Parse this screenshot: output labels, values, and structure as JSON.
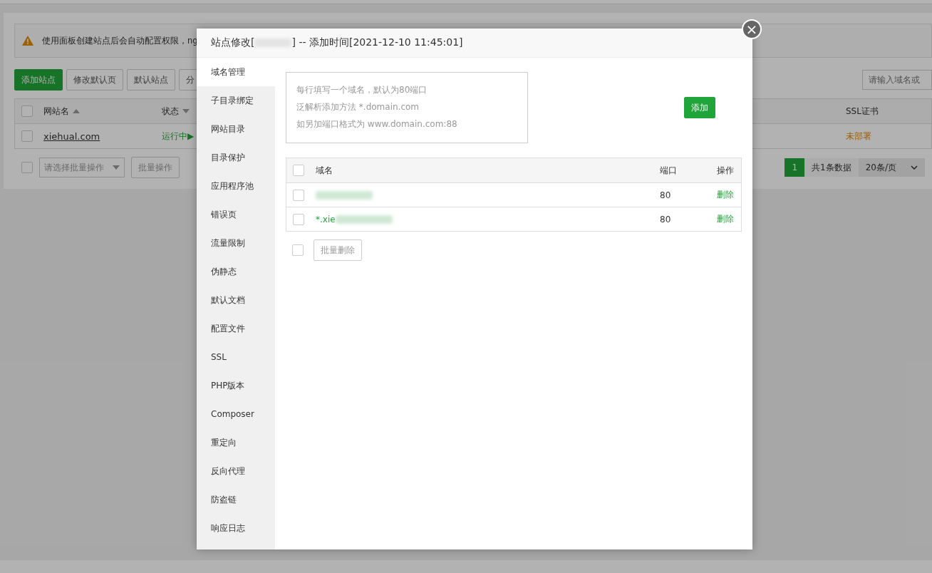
{
  "page": {
    "alert": "使用面板创建站点后会自动配置权限，ng",
    "buttons": [
      {
        "label": "添加站点",
        "kind": "primary"
      },
      {
        "label": "修改默认页",
        "kind": "default"
      },
      {
        "label": "默认站点",
        "kind": "default"
      },
      {
        "label": "分",
        "kind": "default"
      }
    ],
    "search": {
      "placeholder": "请输入域名或"
    },
    "table": {
      "header_checked": false,
      "columns": [
        {
          "label": "网站名",
          "ascending": true
        },
        {
          "label": "状态",
          "ascending": false
        },
        {
          "label": "SSL证书"
        }
      ],
      "rows": [
        {
          "checked": false,
          "name": "xiehual.com",
          "status": "运行中▶",
          "ssl": "未部署"
        }
      ]
    },
    "batch": {
      "checked": false,
      "select_placeholder": "请选择批量操作",
      "button": "批量操作"
    },
    "pagination": {
      "page": "1",
      "total": "共1条数据",
      "per_page": "20条/页"
    }
  },
  "dialog": {
    "title_prefix": "站点修改[",
    "title_suffix": "] -- 添加时间[2021-12-10 11:45:01]",
    "close": "×",
    "tabs": [
      {
        "label": "域名管理",
        "selected": true
      },
      {
        "label": "子目录绑定",
        "selected": false
      },
      {
        "label": "网站目录",
        "selected": false
      },
      {
        "label": "目录保护",
        "selected": false
      },
      {
        "label": "应用程序池",
        "selected": false
      },
      {
        "label": "错误页",
        "selected": false
      },
      {
        "label": "流量限制",
        "selected": false
      },
      {
        "label": "伪静态",
        "selected": false
      },
      {
        "label": "默认文档",
        "selected": false
      },
      {
        "label": "配置文件",
        "selected": false
      },
      {
        "label": "SSL",
        "selected": false
      },
      {
        "label": "PHP版本",
        "selected": false
      },
      {
        "label": "Composer",
        "selected": false
      },
      {
        "label": "重定向",
        "selected": false
      },
      {
        "label": "反向代理",
        "selected": false
      },
      {
        "label": "防盗链",
        "selected": false
      },
      {
        "label": "响应日志",
        "selected": false
      }
    ],
    "domain_input": {
      "placeholder_lines": [
        "每行填写一个域名，默认为80端口",
        "泛解析添加方法 *.domain.com",
        "如另加端口格式为 www.domain.com:88"
      ]
    },
    "add_button": "添加",
    "table": {
      "columns": [
        "域名",
        "端口",
        "操作"
      ],
      "header_checked": false,
      "rows": [
        {
          "checked": false,
          "redacted": true,
          "port": "80",
          "action": "删除"
        },
        {
          "checked": false,
          "domain_visible": "*.xie",
          "redacted": true,
          "port": "80",
          "action": "删除"
        }
      ]
    },
    "bulk": {
      "checked": false,
      "button": "批量删除"
    }
  }
}
